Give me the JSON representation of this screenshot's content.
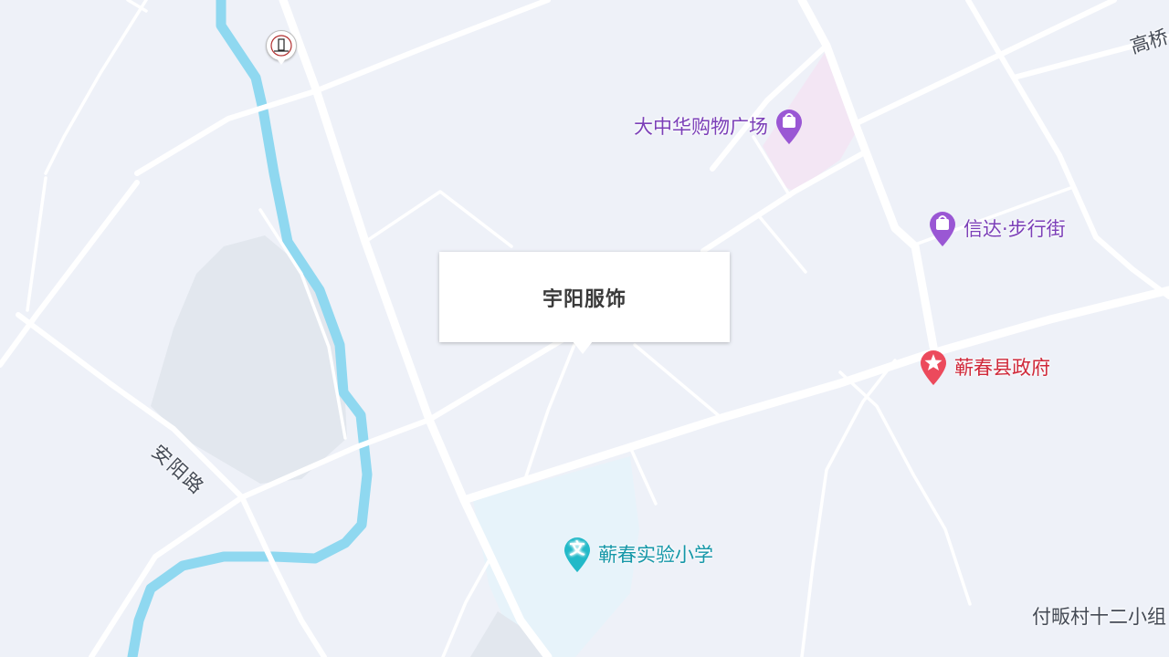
{
  "map": {
    "background": "#eef1f8",
    "road_color": "#ffffff",
    "river_color": "#8fd8f0",
    "mall_area_color": "#f3e6f4",
    "school_area_color": "#e7f3fa",
    "green_area_color": "#e2e7ee"
  },
  "popup": {
    "title": "宇阳服饰"
  },
  "pois": [
    {
      "name": "大中华购物广场",
      "icon": "shopping-bag-icon",
      "color": "#7b3fb8"
    },
    {
      "name": "信达·步行街",
      "icon": "shopping-bag-icon",
      "color": "#7b3fb8"
    },
    {
      "name": "蕲春县政府",
      "icon": "star-icon",
      "color": "#d0293a"
    },
    {
      "name": "蕲春实验小学",
      "icon": "education-icon",
      "glyph": "文",
      "color": "#1597a8"
    }
  ],
  "labels": {
    "road_anyang": "安阳路",
    "area_gaoqiao": "高桥",
    "village": "付畈村十二小组"
  },
  "scenic_marker": {
    "icon": "scenic-spot-icon"
  }
}
